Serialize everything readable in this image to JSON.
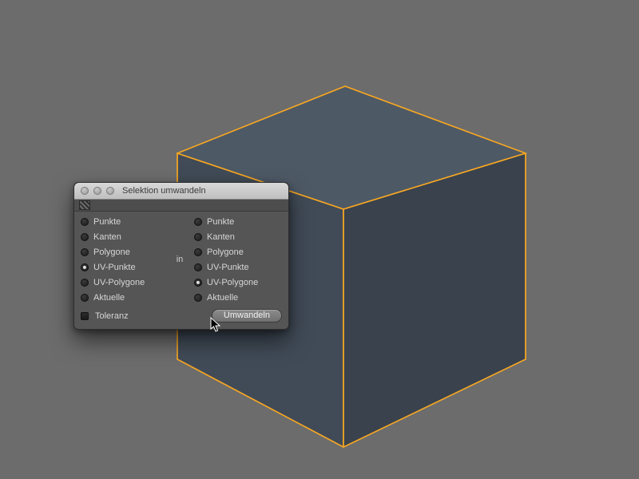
{
  "dialog": {
    "title": "Selektion umwandeln",
    "middle_label": "in",
    "left": {
      "options": [
        "Punkte",
        "Kanten",
        "Polygone",
        "UV-Punkte",
        "UV-Polygone",
        "Aktuelle"
      ],
      "selected_index": 3
    },
    "right": {
      "options": [
        "Punkte",
        "Kanten",
        "Polygone",
        "UV-Punkte",
        "UV-Polygone",
        "Aktuelle"
      ],
      "selected_index": 4
    },
    "toleranz": {
      "label": "Toleranz",
      "checked": false
    },
    "convert_button": "Umwandeln"
  },
  "scene": {
    "object": "cube",
    "edge_color": "#f5a623",
    "face_colors": {
      "top": "#4e5966",
      "left": "#414b57",
      "right": "#39424d"
    }
  }
}
